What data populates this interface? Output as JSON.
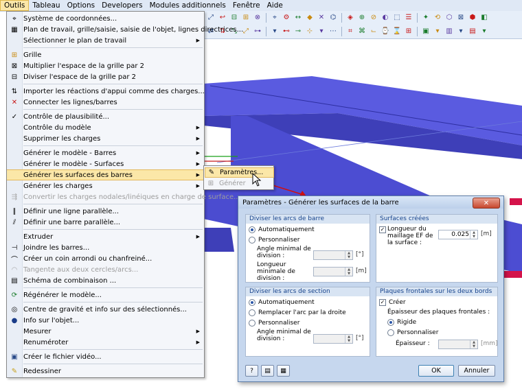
{
  "menubar": {
    "items": [
      "Outils",
      "Tableau",
      "Options",
      "Developers",
      "Modules additionnels",
      "Fenêtre",
      "Aide"
    ],
    "active": "Outils"
  },
  "menu": {
    "items": [
      {
        "label": "Système de coordonnées...",
        "icon": "coordinates-icon"
      },
      {
        "label": "Plan de travail, grille/saisie, saisie de l'objet, lignes directrices...",
        "icon": "workplane-icon"
      },
      {
        "label": "Sélectionner le plan de travail",
        "submenu": true
      },
      {
        "sep": true
      },
      {
        "label": "Grille",
        "icon": "grid-icon"
      },
      {
        "label": "Multiplier l'espace de la grille par 2",
        "icon": "grid-multiply-icon"
      },
      {
        "label": "Diviser l'espace de la grille par 2",
        "icon": "grid-divide-icon"
      },
      {
        "sep": true
      },
      {
        "label": "Importer les réactions d'appui comme des charges...",
        "icon": "import-reactions-icon"
      },
      {
        "label": "Connecter les lignes/barres",
        "icon": "connect-lines-icon"
      },
      {
        "sep": true
      },
      {
        "label": "Contrôle de plausibilité...",
        "icon": "plausibility-icon"
      },
      {
        "label": "Contrôle du modèle",
        "submenu": true
      },
      {
        "label": "Supprimer les charges",
        "submenu": true
      },
      {
        "sep": true
      },
      {
        "label": "Générer le modèle - Barres",
        "submenu": true
      },
      {
        "label": "Générer le modèle - Surfaces",
        "submenu": true
      },
      {
        "label": "Générer les surfaces des barres",
        "submenu": true,
        "highlight": true
      },
      {
        "label": "Générer les charges",
        "submenu": true
      },
      {
        "label": "Convertir les charges nodales/linéiques en charge de surface...",
        "icon": "convert-loads-icon",
        "disabled": true
      },
      {
        "sep": true
      },
      {
        "label": "Définir une ligne parallèle...",
        "icon": "parallel-line-icon"
      },
      {
        "label": "Définir une barre parallèle...",
        "icon": "parallel-member-icon"
      },
      {
        "sep": true
      },
      {
        "label": "Extruder",
        "submenu": true
      },
      {
        "label": "Joindre les barres...",
        "icon": "join-members-icon"
      },
      {
        "label": "Créer un coin arrondi ou chanfreiné...",
        "icon": "fillet-icon"
      },
      {
        "label": "Tangente aux deux cercles/arcs...",
        "icon": "tangent-icon",
        "disabled": true
      },
      {
        "label": "Schéma de combinaison ...",
        "icon": "combination-scheme-icon"
      },
      {
        "sep": true
      },
      {
        "label": "Régénérer le modèle...",
        "icon": "regenerate-icon"
      },
      {
        "sep": true
      },
      {
        "label": "Centre de gravité et info sur des sélectionnés...",
        "icon": "center-gravity-icon"
      },
      {
        "label": "Info sur l'objet...",
        "icon": "info-icon"
      },
      {
        "label": "Mesurer",
        "submenu": true
      },
      {
        "label": "Renuméroter",
        "submenu": true
      },
      {
        "sep": true
      },
      {
        "label": "Créer le fichier vidéo...",
        "icon": "video-icon"
      },
      {
        "sep": true
      },
      {
        "label": "Redessiner",
        "icon": "pencil-icon"
      }
    ]
  },
  "submenu": {
    "parametres": "Paramètres...",
    "generer": "Générer"
  },
  "dialog": {
    "title": "Paramètres - Générer les surfaces de la barre",
    "arcs_barre": {
      "header": "Diviser les arcs de barre",
      "auto": "Automatiquement",
      "perso": "Personnaliser",
      "angle_label": "Angle minimal de division :",
      "angle_unit": "[°]",
      "longueur_label": "Longueur minimale de division :",
      "longueur_unit": "[m]"
    },
    "surfaces": {
      "header": "Surfaces créées",
      "longueur_label": "Longueur du maillage EF de la surface :",
      "longueur_value": "0.025",
      "longueur_unit": "[m]"
    },
    "arcs_section": {
      "header": "Diviser les arcs de section",
      "auto": "Automatiquement",
      "remplacer": "Remplacer l'arc par la droite",
      "perso": "Personnaliser",
      "angle_label": "Angle minimal de division :",
      "angle_unit": "[°]"
    },
    "plaques": {
      "header": "Plaques frontales sur les deux bords",
      "creer": "Créer",
      "epaisseur_title": "Épaisseur des plaques frontales :",
      "rigide": "Rigide",
      "perso": "Personnaliser",
      "epaisseur_label": "Épaisseur :",
      "epaisseur_unit": "[mm]"
    },
    "ok": "OK",
    "annuler": "Annuler"
  },
  "colors": {
    "beam": "#5a5be0",
    "beam_dark": "#3e3fb8",
    "menu_highlight": "#fbe7a8",
    "arrow": "#d01010",
    "support": "#d4134a"
  }
}
